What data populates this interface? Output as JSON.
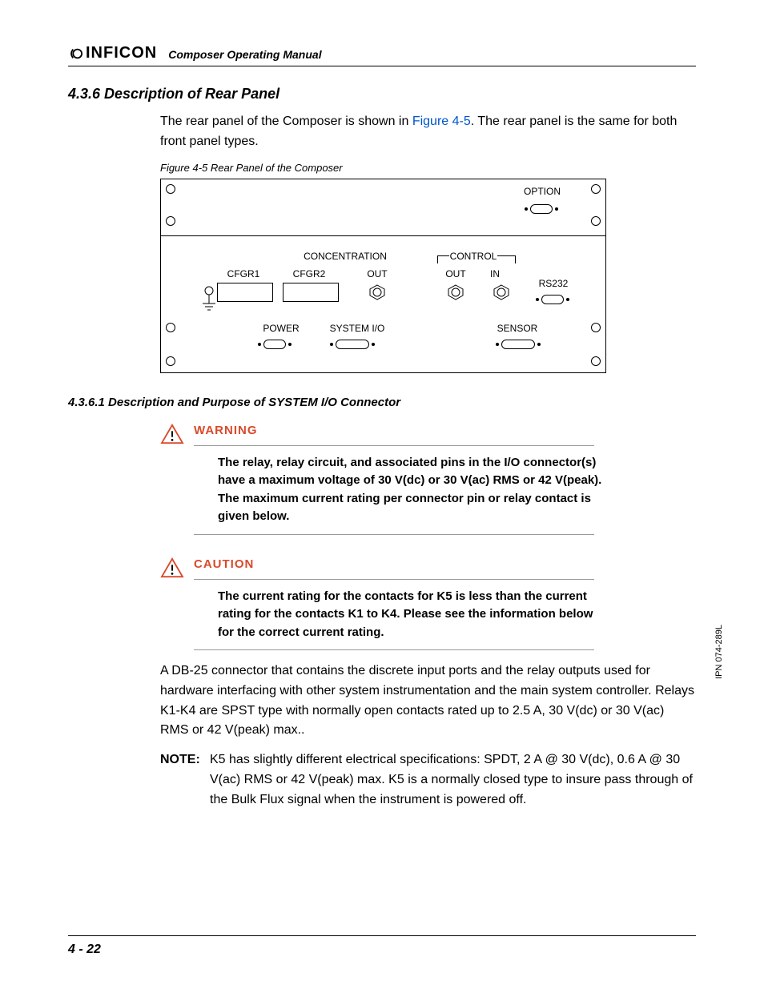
{
  "header": {
    "brand": "INFICON",
    "doc_title": "Composer Operating Manual"
  },
  "section": {
    "number_title": "4.3.6  Description of Rear Panel",
    "intro_pre": "The rear panel of the Composer is shown in ",
    "intro_ref": "Figure 4-5",
    "intro_post": ". The rear panel is the same for both front panel types."
  },
  "figure": {
    "caption": "Figure 4-5  Rear Panel of the Composer",
    "labels": {
      "option": "OPTION",
      "concentration": "CONCENTRATION",
      "control": "CONTROL",
      "cfgr1": "CFGR1",
      "cfgr2": "CFGR2",
      "out1": "OUT",
      "out2": "OUT",
      "in": "IN",
      "rs232": "RS232",
      "power": "POWER",
      "sysio": "SYSTEM I/O",
      "sensor": "SENSOR"
    }
  },
  "subsection": {
    "number_title": "4.3.6.1  Description and Purpose of SYSTEM I/O Connector"
  },
  "warning": {
    "title": "WARNING",
    "body": "The relay, relay circuit, and associated pins in the I/O connector(s) have a maximum voltage of 30 V(dc) or 30 V(ac) RMS or 42 V(peak). The maximum current rating per connector pin or relay contact is given below."
  },
  "caution": {
    "title": "CAUTION",
    "body": "The current rating for the contacts for K5 is less than the current rating for the contacts K1 to K4. Please see the information below for the correct current rating."
  },
  "paragraph": "A DB-25 connector that contains the discrete input ports and the relay outputs used for hardware interfacing with other system instrumentation and the main system controller. Relays K1-K4 are SPST type with normally open contacts rated up to 2.5 A, 30 V(dc) or 30 V(ac) RMS or 42 V(peak) max..",
  "note": {
    "label": "NOTE:",
    "text": "K5 has slightly different electrical specifications: SPDT, 2 A @ 30 V(dc), 0.6 A @ 30 V(ac) RMS or 42 V(peak) max. K5 is a normally closed type to insure pass through of the Bulk Flux signal when the instrument is powered off."
  },
  "side_code": "IPN 074-289L",
  "page_number": "4 - 22"
}
